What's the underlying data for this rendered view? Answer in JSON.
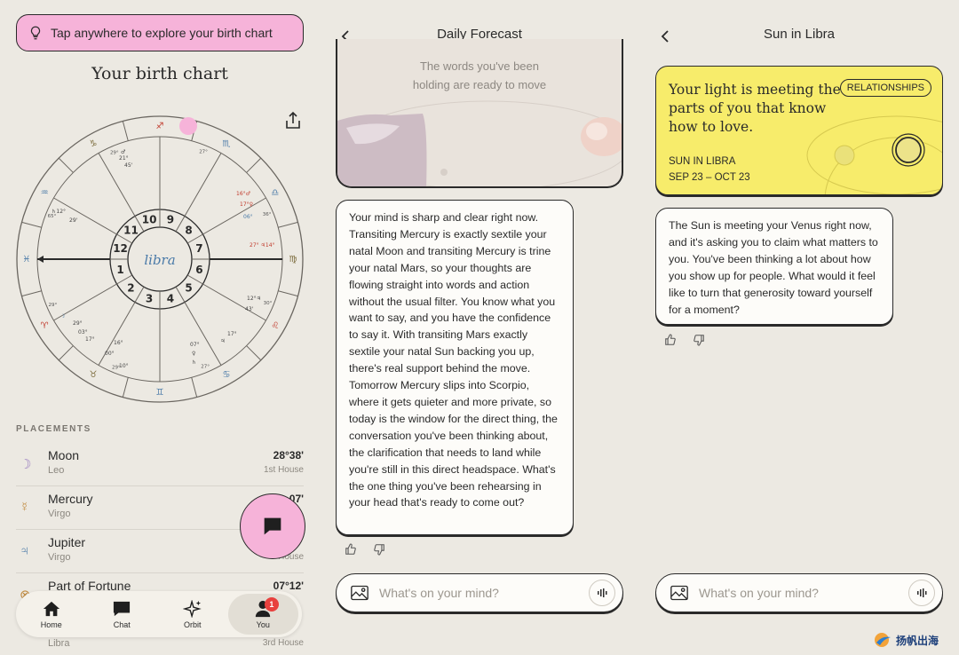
{
  "panel1": {
    "tap_banner": "Tap anywhere to explore your birth chart",
    "title": "Your birth chart",
    "wheel": {
      "center_label": "libra",
      "houses": [
        "1",
        "2",
        "3",
        "4",
        "5",
        "6",
        "7",
        "8",
        "9",
        "10",
        "11",
        "12"
      ],
      "cusp_degrees": [
        "30°",
        "27°",
        "29°",
        "29°",
        "65°",
        "29°",
        "27°",
        "36°"
      ],
      "glyphs": [
        "♈",
        "♉",
        "♊",
        "♋",
        "♌",
        "♍",
        "♎",
        "♏",
        "♐",
        "♑",
        "♒",
        "♓"
      ]
    },
    "placements_label": "PLACEMENTS",
    "placements": [
      {
        "glyph": "☽",
        "name": "Moon",
        "sign": "Leo",
        "degree": "28°38'",
        "house": "1st House"
      },
      {
        "glyph": "☿",
        "name": "Mercury",
        "sign": "Virgo",
        "degree": "07'",
        "house": ""
      },
      {
        "glyph": "♃",
        "name": "Jupiter",
        "sign": "Virgo",
        "degree": "",
        "house": "House"
      },
      {
        "glyph": "⊗",
        "name": "Part of Fortune",
        "sign": "Libra",
        "degree": "07°12'",
        "house": "3rd House"
      }
    ],
    "nav": [
      {
        "label": "Home",
        "icon": "home-icon"
      },
      {
        "label": "Chat",
        "icon": "chat-icon"
      },
      {
        "label": "Orbit",
        "icon": "sparkle-icon"
      },
      {
        "label": "You",
        "icon": "person-icon",
        "badge": "1"
      }
    ]
  },
  "panel2": {
    "title": "Daily Forecast",
    "card_quote": "The words you've been holding are ready to move",
    "message": "Your mind is sharp and clear right now. Transiting Mercury is exactly sextile your natal Moon and transiting Mercury is trine your natal Mars, so your thoughts are flowing straight into words and action without the usual filter. You know what you want to say, and you have the confidence to say it. With transiting Mars exactly sextile your natal Sun backing you up, there's real support behind the move. Tomorrow Mercury slips into Scorpio, where it gets quieter and more private, so today is the window for the direct thing, the conversation you've been thinking about, the clarification that needs to land while you're still in this direct headspace. What's the one thing you've been rehearsing in your head that's ready to come out?",
    "input_placeholder": "What's on your mind?"
  },
  "panel3": {
    "title": "Sun in Libra",
    "card_quote": "Your light is meeting the parts of you that know how to love.",
    "tag": "RELATIONSHIPS",
    "placement": "SUN IN LIBRA",
    "dates": "SEP 23 – OCT 23",
    "message": "The Sun is meeting your Venus right now, and it's asking you to claim what matters to you. You've been thinking a lot about how you show up for people. What would it feel like to turn that generosity toward yourself for a moment?",
    "input_placeholder": "What's on your mind?"
  },
  "watermark": "扬帆出海",
  "colors": {
    "pink": "#f6b3d9",
    "yellow": "#f7ec6b",
    "bg": "#ece9e2",
    "badge": "#e8413e"
  }
}
